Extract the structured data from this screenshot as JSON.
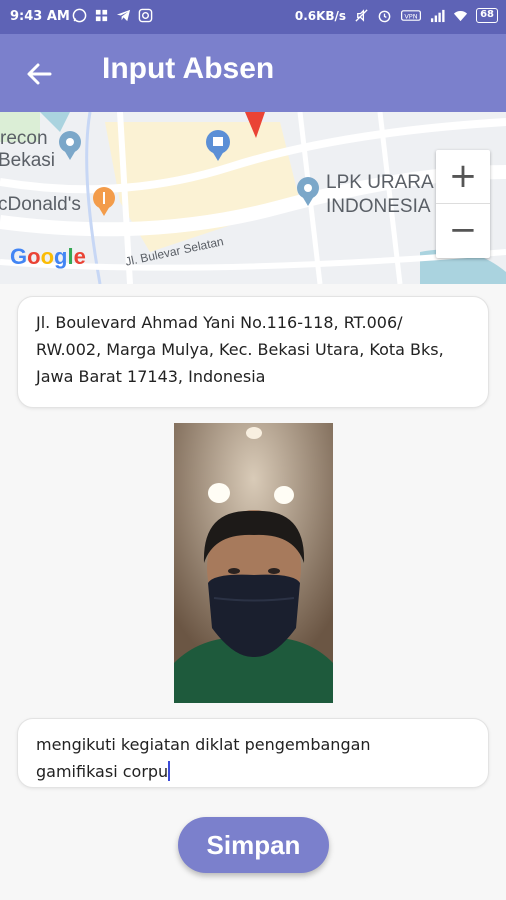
{
  "status_bar": {
    "time": "9:43 AM",
    "net_speed": "0.6KB/s",
    "battery": "68",
    "left_icons": [
      "whatsapp-icon",
      "grid-icon",
      "telegram-icon",
      "edge-icon"
    ],
    "right_icons": [
      "mute-icon",
      "alarm-icon",
      "vpn-icon",
      "signal-icon",
      "wifi-icon"
    ]
  },
  "app_bar": {
    "title": "Input Absen",
    "back_icon": "arrow-left-icon"
  },
  "map": {
    "labels": {
      "precon": "recon",
      "bekasi": "Bekasi",
      "mcdonalds": "cDonald's",
      "lpk_line1": "LPK URARA",
      "lpk_line2": "INDONESIA",
      "road": "Jl. Bulevar Selatan"
    },
    "google_logo": [
      "G",
      "o",
      "o",
      "g",
      "l",
      "e"
    ],
    "zoom_in": "+",
    "zoom_out": "−",
    "colors": {
      "pin": "#ea4335",
      "poi": "#7ba7c9",
      "food": "#f39c4a",
      "water": "#aad3df"
    }
  },
  "address": {
    "line1": "Jl. Boulevard Ahmad Yani No.116-118, RT.006/",
    "line2": "RW.002, Marga Mulya, Kec. Bekasi Utara, Kota Bks,",
    "line3": "Jawa Barat 17143, Indonesia"
  },
  "note": {
    "line1": "mengikuti kegiatan diklat pengembangan",
    "line2": "gamifikasi corpu"
  },
  "save_button": {
    "label": "Simpan"
  },
  "colors": {
    "primary": "#7b80cc",
    "status_bar": "#5e63b6"
  }
}
